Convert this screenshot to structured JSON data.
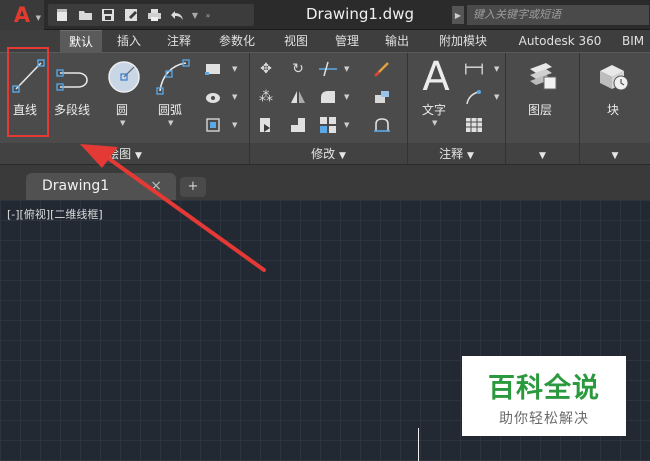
{
  "app": {
    "logo_letter": "A",
    "logo_color": "#e23b2e"
  },
  "titlebar": {
    "document_title": "Drawing1.dwg",
    "search_placeholder": "键入关键字或短语",
    "qat_icons": [
      "new-icon",
      "open-icon",
      "save-icon",
      "save-as-icon",
      "print-icon",
      "undo-icon",
      "dropdown-icon",
      "more-icon"
    ]
  },
  "ribbon_tabs": [
    {
      "label": "默认",
      "active": true
    },
    {
      "label": "插入"
    },
    {
      "label": "注释"
    },
    {
      "label": "参数化"
    },
    {
      "label": "视图"
    },
    {
      "label": "管理"
    },
    {
      "label": "输出"
    },
    {
      "label": "附加模块"
    },
    {
      "label": "Autodesk 360"
    },
    {
      "label": "BIM"
    }
  ],
  "panels": {
    "draw": {
      "title": "绘图",
      "tools": {
        "line": "直线",
        "polyline": "多段线",
        "circle": "圆",
        "arc": "圆弧"
      }
    },
    "modify": {
      "title": "修改"
    },
    "annotation": {
      "title": "注释",
      "text_tool": "文字",
      "text_glyph": "A"
    },
    "layers": {
      "tool": "图层"
    },
    "block": {
      "tool": "块"
    }
  },
  "document_tabs": {
    "active_tab": "Drawing1",
    "close_glyph": "×",
    "new_tab_glyph": "+"
  },
  "viewport": {
    "label": "[-][俯视][二维线框]"
  },
  "watermark": {
    "title": "百科全说",
    "subtitle": "助你轻松解决"
  },
  "colors": {
    "canvas_bg": "#222933",
    "highlight": "#e53935",
    "watermark_green": "#2b9a3e"
  }
}
